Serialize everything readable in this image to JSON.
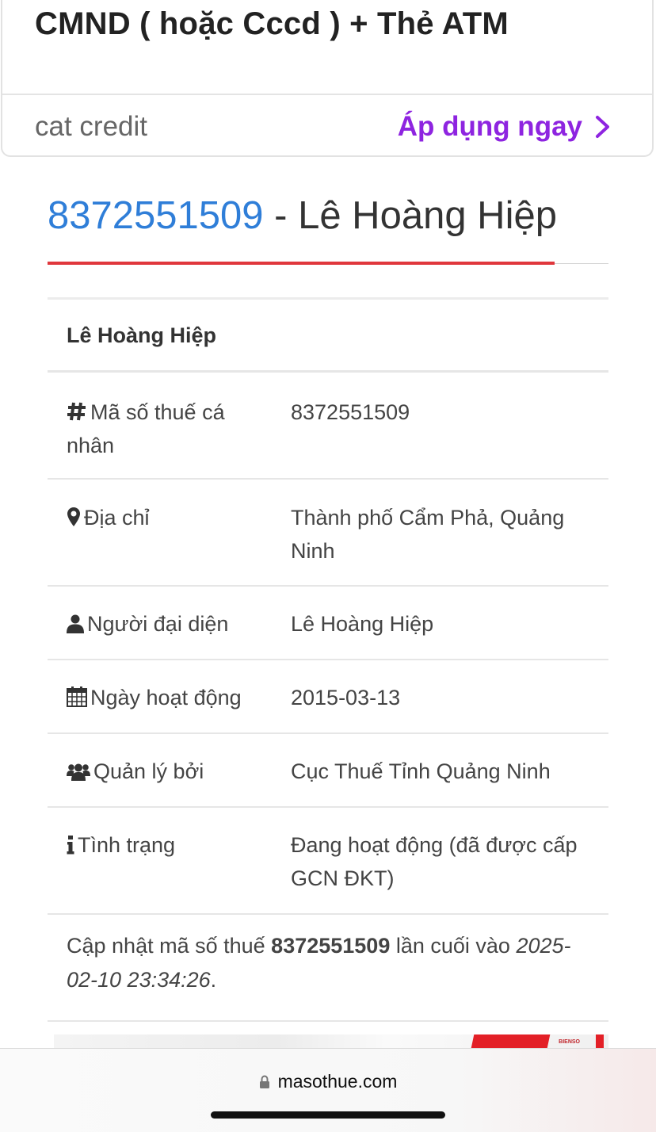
{
  "ad": {
    "title": "CMND ( hoặc Cccd ) + Thẻ ATM",
    "brand": "cat credit",
    "cta": "Áp dụng ngay",
    "accent_color": "#8e24e0"
  },
  "heading": {
    "tax_code": "8372551509",
    "separator": " - ",
    "name": "Lê Hoàng Hiệp",
    "link_color": "#2f7ed8",
    "underline_color": "#e0373c"
  },
  "details": {
    "name": "Lê Hoàng Hiệp",
    "rows": [
      {
        "icon": "hash-icon",
        "label": "Mã số thuế cá nhân",
        "value": "8372551509"
      },
      {
        "icon": "map-marker-icon",
        "label": "Địa chỉ",
        "value": "Thành phố Cẩm Phả, Quảng Ninh"
      },
      {
        "icon": "user-icon",
        "label": "Người đại diện",
        "value": "Lê Hoàng Hiệp"
      },
      {
        "icon": "calendar-icon",
        "label": "Ngày hoạt động",
        "value": "2015-03-13"
      },
      {
        "icon": "users-icon",
        "label": "Quản lý bởi",
        "value": "Cục Thuế Tỉnh Quảng Ninh"
      },
      {
        "icon": "info-icon",
        "label": "Tình trạng",
        "value": "Đang hoạt động (đã được cấp GCN ĐKT)"
      }
    ],
    "update_note": {
      "prefix": "Cập nhật mã số thuế ",
      "code": "8372551509",
      "middle": " lần cuối vào ",
      "date": "2025-02-10 23:34:26",
      "suffix": "."
    }
  },
  "bottom_ad": {
    "tiny_text": "BIENSO"
  },
  "browser": {
    "url": "masothue.com"
  }
}
